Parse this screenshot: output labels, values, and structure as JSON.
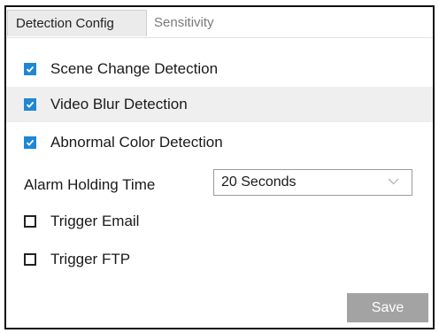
{
  "tabs": {
    "detection_config": "Detection Config",
    "sensitivity": "Sensitivity"
  },
  "options": {
    "scene_change": {
      "label": "Scene Change Detection",
      "checked": true
    },
    "video_blur": {
      "label": "Video Blur Detection",
      "checked": true
    },
    "abnormal_color": {
      "label": "Abnormal Color Detection",
      "checked": true
    },
    "trigger_email": {
      "label": "Trigger Email",
      "checked": false
    },
    "trigger_ftp": {
      "label": "Trigger FTP",
      "checked": false
    }
  },
  "alarm_holding": {
    "label": "Alarm Holding Time",
    "value": "20 Seconds"
  },
  "save_label": "Save",
  "colors": {
    "checkbox_checked": "#1e87d6",
    "save_button": "#a3a3a3",
    "active_tab": "#ebebeb",
    "row_highlight": "#efefef"
  },
  "icons": {
    "checked": "checkmark-icon",
    "dropdown": "chevron-down-icon"
  }
}
